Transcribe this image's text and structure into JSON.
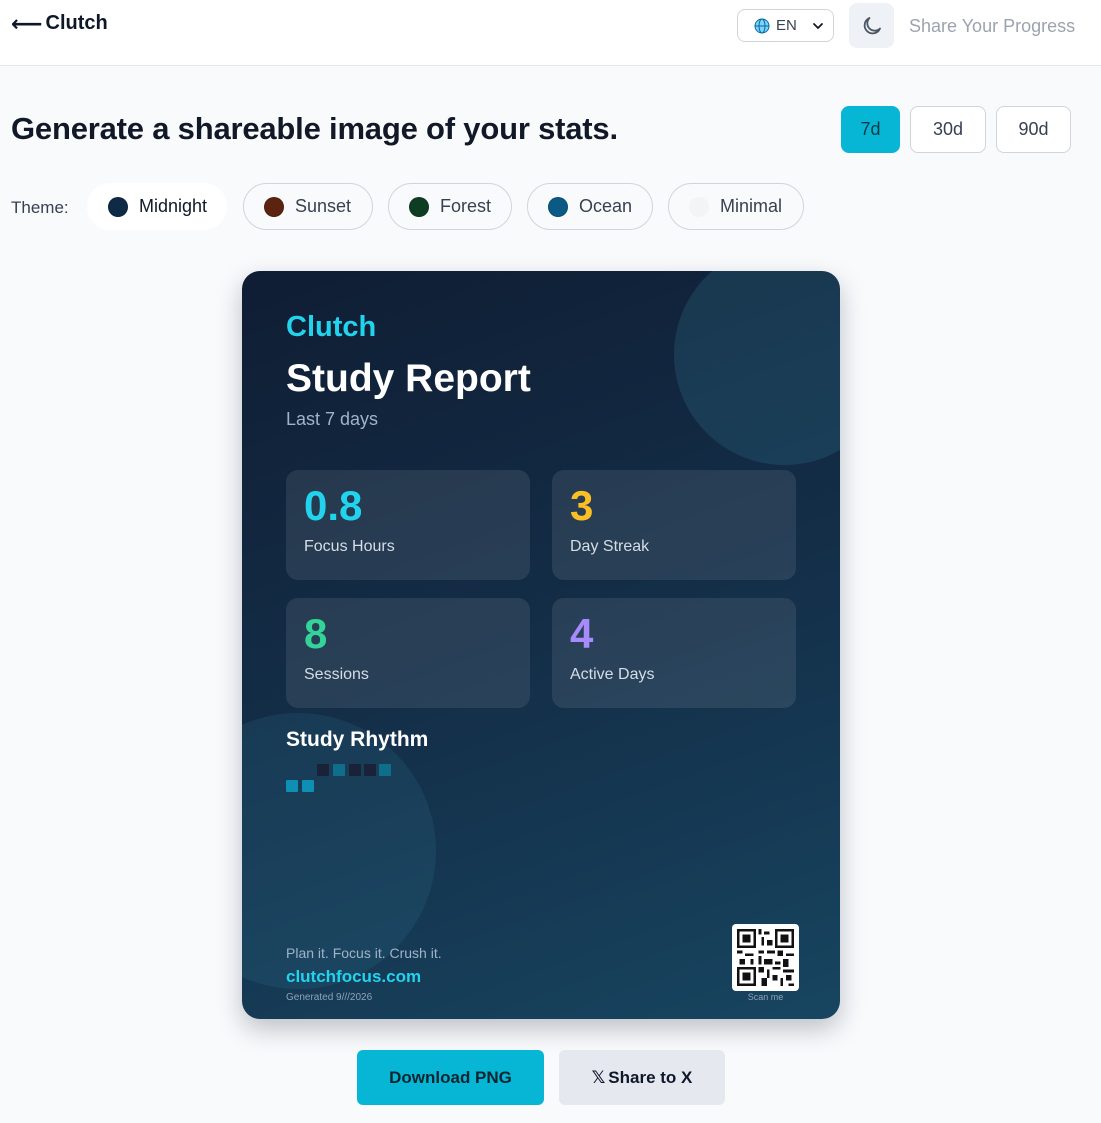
{
  "header": {
    "back_label": "Clutch",
    "language": "EN",
    "share_link": "Share Your Progress"
  },
  "headline": "Generate a shareable image of your stats.",
  "ranges": [
    {
      "label": "7d",
      "active": true
    },
    {
      "label": "30d",
      "active": false
    },
    {
      "label": "90d",
      "active": false
    }
  ],
  "theme": {
    "label": "Theme:",
    "options": [
      {
        "name": "Midnight",
        "color": "#0f2a44",
        "selected": true
      },
      {
        "name": "Sunset",
        "color": "#5b2411",
        "selected": false
      },
      {
        "name": "Forest",
        "color": "#0f3d23",
        "selected": false
      },
      {
        "name": "Ocean",
        "color": "#0a5a85",
        "selected": false
      },
      {
        "name": "Minimal",
        "color": "#f3f4f6",
        "selected": false
      }
    ]
  },
  "card": {
    "brand": "Clutch",
    "title": "Study Report",
    "subtitle": "Last 7 days",
    "stats": [
      {
        "value": "0.8",
        "label": "Focus Hours",
        "color": "#22d3ee"
      },
      {
        "value": "3",
        "label": "Day Streak",
        "color": "#fbbf24"
      },
      {
        "value": "8",
        "label": "Sessions",
        "color": "#34d399"
      },
      {
        "value": "4",
        "label": "Active Days",
        "color": "#a78bfa"
      }
    ],
    "rhythm_title": "Study Rhythm",
    "tagline": "Plan it. Focus it. Crush it.",
    "site": "clutchfocus.com",
    "generated": "Generated 9///2026",
    "scan_label": "Scan me"
  },
  "actions": {
    "download": "Download PNG",
    "share_x": "Share to X",
    "x_glyph": "𝕏"
  },
  "colors": {
    "accent": "#06b6d4",
    "card_bg": "#14304a"
  }
}
